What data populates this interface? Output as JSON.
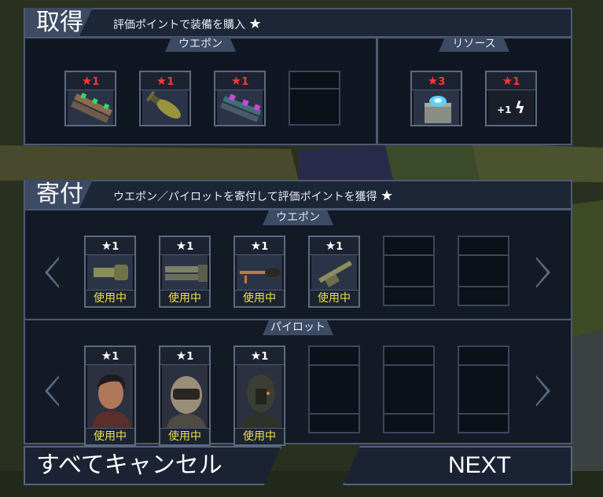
{
  "acquire": {
    "title": "取得",
    "description": "評価ポイントで装備を購入",
    "weapons_tab": "ウエポン",
    "resources_tab": "リソース",
    "weapons": [
      {
        "cost": "1",
        "icon": "missile-rack-green-icon"
      },
      {
        "cost": "1",
        "icon": "bomb-icon"
      },
      {
        "cost": "1",
        "icon": "missile-rack-purple-icon"
      }
    ],
    "resources": [
      {
        "cost": "3",
        "icon": "reactor-core-icon"
      },
      {
        "cost": "1",
        "icon": "power-plus-one-icon",
        "label": "+1"
      }
    ]
  },
  "donate": {
    "title": "寄付",
    "description": "ウエポン／パイロットを寄付して評価ポイントを獲得",
    "weapons_tab": "ウエポン",
    "pilots_tab": "パイロット",
    "weapons": [
      {
        "value": "1",
        "status": "使用中",
        "icon": "gauntlet-weapon-icon"
      },
      {
        "value": "1",
        "status": "使用中",
        "icon": "twin-cannon-icon"
      },
      {
        "value": "1",
        "status": "使用中",
        "icon": "rocket-launcher-icon"
      },
      {
        "value": "1",
        "status": "使用中",
        "icon": "artillery-gun-icon"
      }
    ],
    "pilots": [
      {
        "value": "1",
        "status": "使用中",
        "icon": "pilot-human-portrait"
      },
      {
        "value": "1",
        "status": "使用中",
        "icon": "pilot-mech-helmet-portrait"
      },
      {
        "value": "1",
        "status": "使用中",
        "icon": "pilot-dark-helmet-portrait"
      }
    ]
  },
  "buttons": {
    "cancel_all": "すべてキャンセル",
    "next": "NEXT"
  },
  "colors": {
    "cost_star": "#ff3838",
    "status_text": "#f0e04a",
    "panel_border": "#4c5a73"
  }
}
